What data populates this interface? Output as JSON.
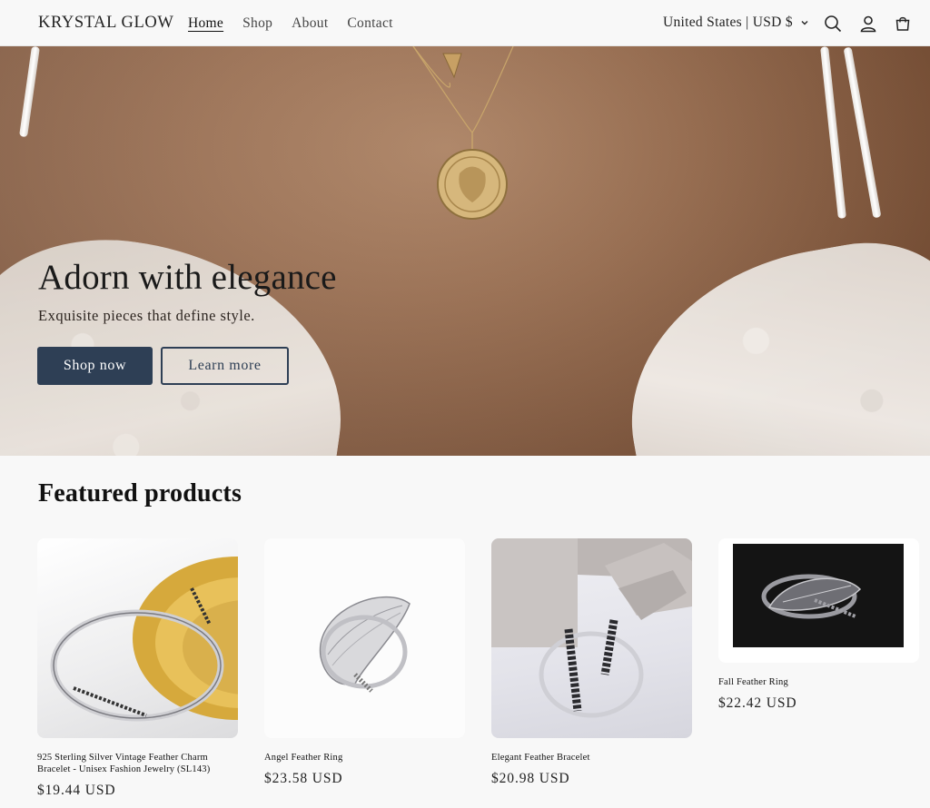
{
  "header": {
    "logo": "KRYSTAL GLOW",
    "nav": [
      "Home",
      "Shop",
      "About",
      "Contact"
    ],
    "active_nav": "Home",
    "locale": "United States | USD $",
    "icons": [
      "search-icon",
      "account-icon",
      "cart-icon"
    ]
  },
  "hero": {
    "title": "Adorn with elegance",
    "subtitle": "Exquisite pieces that define style.",
    "primary_button": "Shop now",
    "secondary_button": "Learn more"
  },
  "featured": {
    "title": "Featured products",
    "products": [
      {
        "name": "925 Sterling Silver Vintage Feather Charm Bracelet - Unisex Fashion Jewelry (SL143)",
        "price": "$19.44 USD"
      },
      {
        "name": "Angel Feather Ring",
        "price": "$23.58 USD"
      },
      {
        "name": "Elegant Feather Bracelet",
        "price": "$20.98 USD"
      },
      {
        "name": "Fall Feather Ring",
        "price": "$22.42 USD"
      }
    ]
  },
  "colors": {
    "accent": "#2e3f55",
    "background": "#f8f8f8",
    "text": "#222222"
  }
}
